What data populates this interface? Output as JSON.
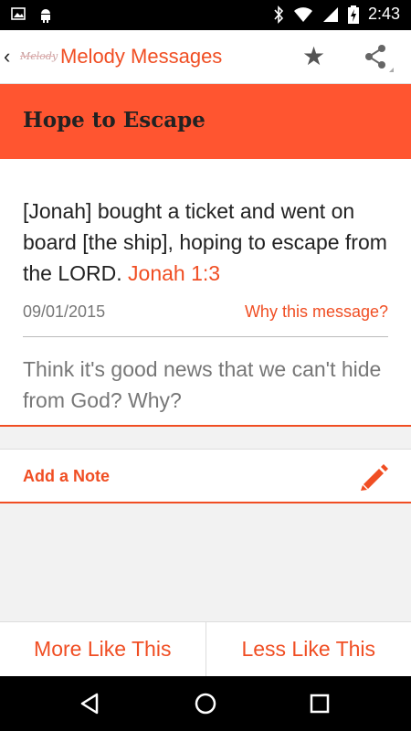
{
  "status_bar": {
    "time": "2:43",
    "left_icons": [
      "image-icon",
      "android-icon"
    ],
    "right_icons": [
      "bluetooth-icon",
      "wifi-icon",
      "signal-icon",
      "battery-charging-icon"
    ]
  },
  "app_bar": {
    "logo_text": "Melody",
    "title": "Melody Messages",
    "icons": [
      "back-icon",
      "star-icon",
      "share-icon"
    ]
  },
  "header": {
    "title": "Hope to Escape"
  },
  "message": {
    "verse_text": "[Jonah] bought a ticket and went on board [the ship], hoping to escape from the LORD.",
    "verse_ref": "Jonah 1:3",
    "date": "09/01/2015",
    "why_link": "Why this message?",
    "question": "Think it's good news that we can't hide from God? Why?"
  },
  "note": {
    "label": "Add a Note",
    "icon": "pencil-icon"
  },
  "buttons": {
    "more": "More Like This",
    "less": "Less Like This"
  },
  "colors": {
    "accent": "#f04e23",
    "header_band": "#ff5530",
    "text": "#222222",
    "muted": "#777777"
  }
}
